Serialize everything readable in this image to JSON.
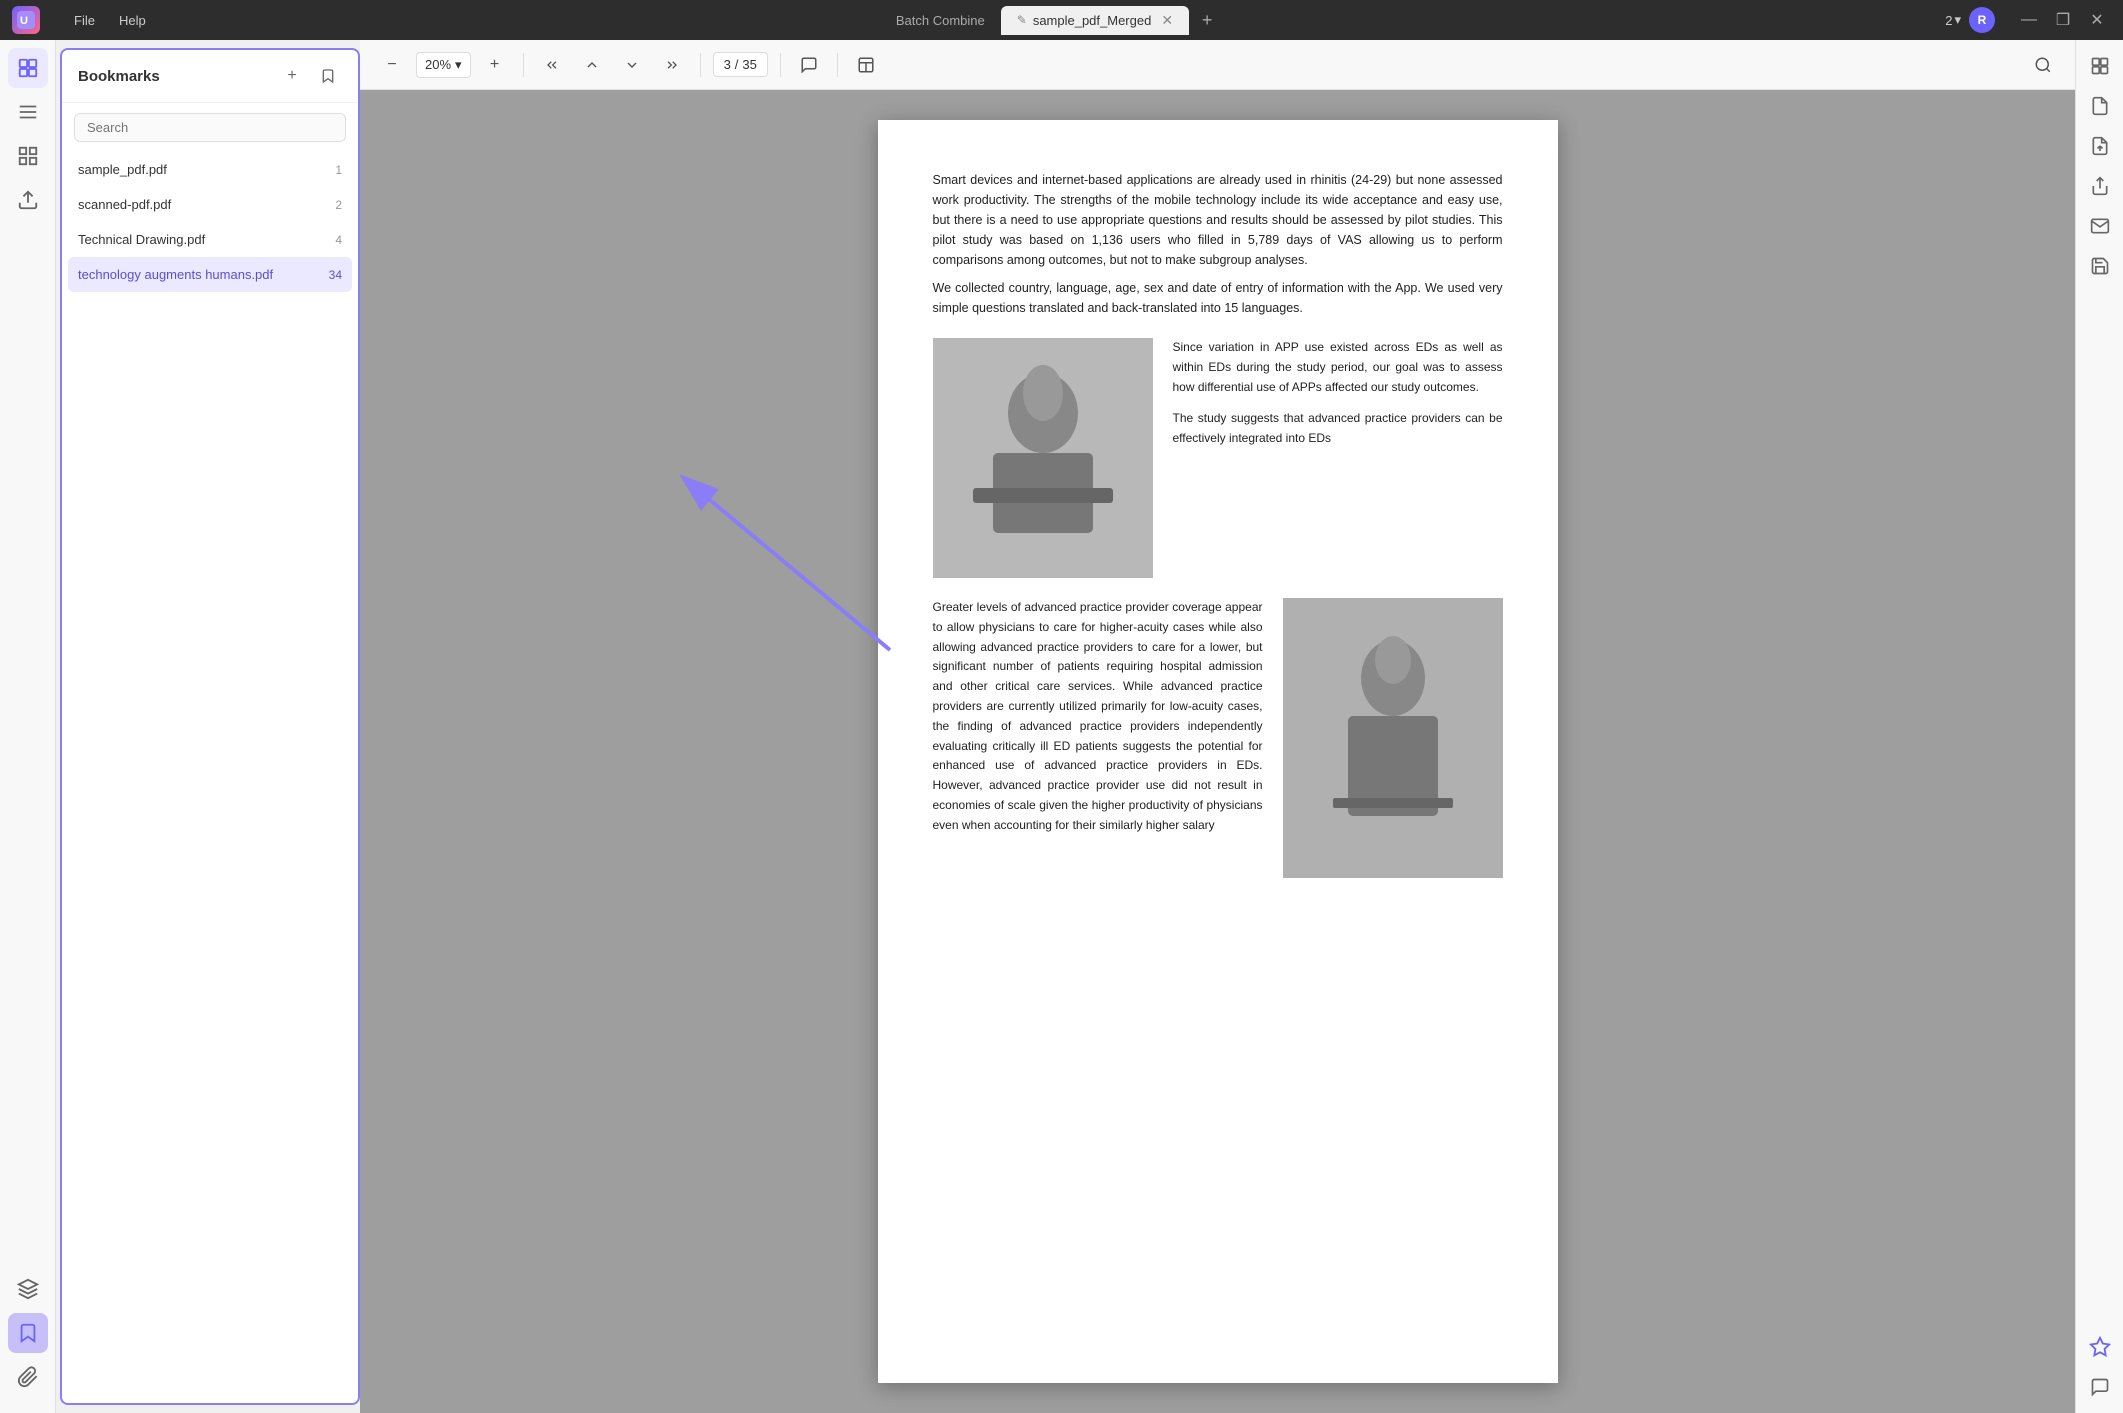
{
  "titlebar": {
    "logo_text": "UPDF",
    "menu_items": [
      "File",
      "Help"
    ],
    "batch_combine_label": "Batch Combine",
    "tab_dirty_icon": "✎",
    "tab_name": "sample_pdf_Merged",
    "tab_add": "+",
    "count_label": "2",
    "avatar_initial": "R",
    "win_minimize": "—",
    "win_maximize": "❒",
    "win_close": "✕"
  },
  "toolbar": {
    "zoom_out": "−",
    "zoom_level": "20%",
    "zoom_dropdown": "▾",
    "zoom_in": "+",
    "nav_first": "⏮",
    "nav_prev": "▲",
    "nav_next": "▼",
    "nav_last": "⏭",
    "page_current": "3",
    "page_sep": "/",
    "page_total": "35",
    "comment_icon": "💬",
    "layout_icon": "⊟",
    "search_icon": "🔍"
  },
  "bookmarks": {
    "title": "Bookmarks",
    "add_icon": "+",
    "bookmark_icon": "🔖",
    "search_placeholder": "Search",
    "items": [
      {
        "name": "sample_pdf.pdf",
        "count": "1"
      },
      {
        "name": "scanned-pdf.pdf",
        "count": "2"
      },
      {
        "name": "Technical Drawing.pdf",
        "count": "4"
      },
      {
        "name": "technology augments humans.pdf",
        "count": "34",
        "active": true
      }
    ]
  },
  "sidebar_icons": [
    {
      "icon": "📄",
      "name": "page-thumbnail-icon",
      "active": true
    },
    {
      "icon": "≡",
      "name": "outline-icon"
    },
    {
      "icon": "⊞",
      "name": "bookmark-panel-icon"
    },
    {
      "icon": "📎",
      "name": "attachment-icon"
    },
    {
      "icon": "🔖",
      "name": "bookmarks-icon",
      "active_panel": true
    },
    {
      "icon": "✍",
      "name": "annotate-icon"
    },
    {
      "icon": "⊟",
      "name": "pages-icon"
    },
    {
      "icon": "📋",
      "name": "forms-icon"
    }
  ],
  "sidebar_bottom": [
    {
      "icon": "◈",
      "name": "layers-icon"
    },
    {
      "icon": "🔖",
      "name": "bookmark-bottom-icon",
      "active": true
    }
  ],
  "right_sidebar": [
    {
      "icon": "⊞",
      "name": "right-thumbnail-icon"
    },
    {
      "icon": "📄",
      "name": "right-page-icon"
    },
    {
      "icon": "🔖",
      "name": "right-extract-icon"
    },
    {
      "icon": "↑",
      "name": "right-upload-icon"
    },
    {
      "icon": "✉",
      "name": "right-email-icon"
    },
    {
      "icon": "💾",
      "name": "right-save-icon"
    }
  ],
  "right_sidebar_bottom": [
    {
      "icon": "✦",
      "name": "right-ai-icon"
    },
    {
      "icon": "💬",
      "name": "right-comment-icon"
    }
  ],
  "pdf_content": {
    "para1": "Smart devices and internet-based applications are already used in rhinitis (24-29) but none assessed work productivity. The strengths of the mobile technology include its wide acceptance and easy use, but there is a need to use appropriate questions and results should be assessed by pilot studies. This pilot study was based on 1,136 users who filled in 5,789 days of VAS allowing us to perform comparisons among outcomes, but not to make subgroup analyses.",
    "para1b": "We collected country, language, age, sex and date of entry of information with the App. We used very simple questions translated and back-translated into 15 languages.",
    "para_right": "Since variation in APP use existed across EDs as well as within EDs during the study period, our goal was to assess how differential use of APPs affected our study outcomes.\n\nThe study suggests that advanced practice providers can be effectively integrated into EDs",
    "para2": "Greater levels of advanced practice provider coverage appear to allow physicians to care for higher-acuity cases while also allowing advanced practice providers to care for a lower, but significant number of patients requiring hospital admission and other critical care services. While advanced practice providers are currently utilized primarily for low-acuity cases, the finding of advanced practice providers independently evaluating critically ill ED patients suggests the potential for enhanced use of advanced practice providers in EDs. However, advanced practice provider use did not result in economies of scale given the higher productivity of physicians even when accounting for their similarly higher salary"
  },
  "colors": {
    "accent": "#8b7cf8",
    "accent_light": "#ebe9ff",
    "active_item_bg": "#c7bff8",
    "arrow_color": "#8b7cf8"
  }
}
